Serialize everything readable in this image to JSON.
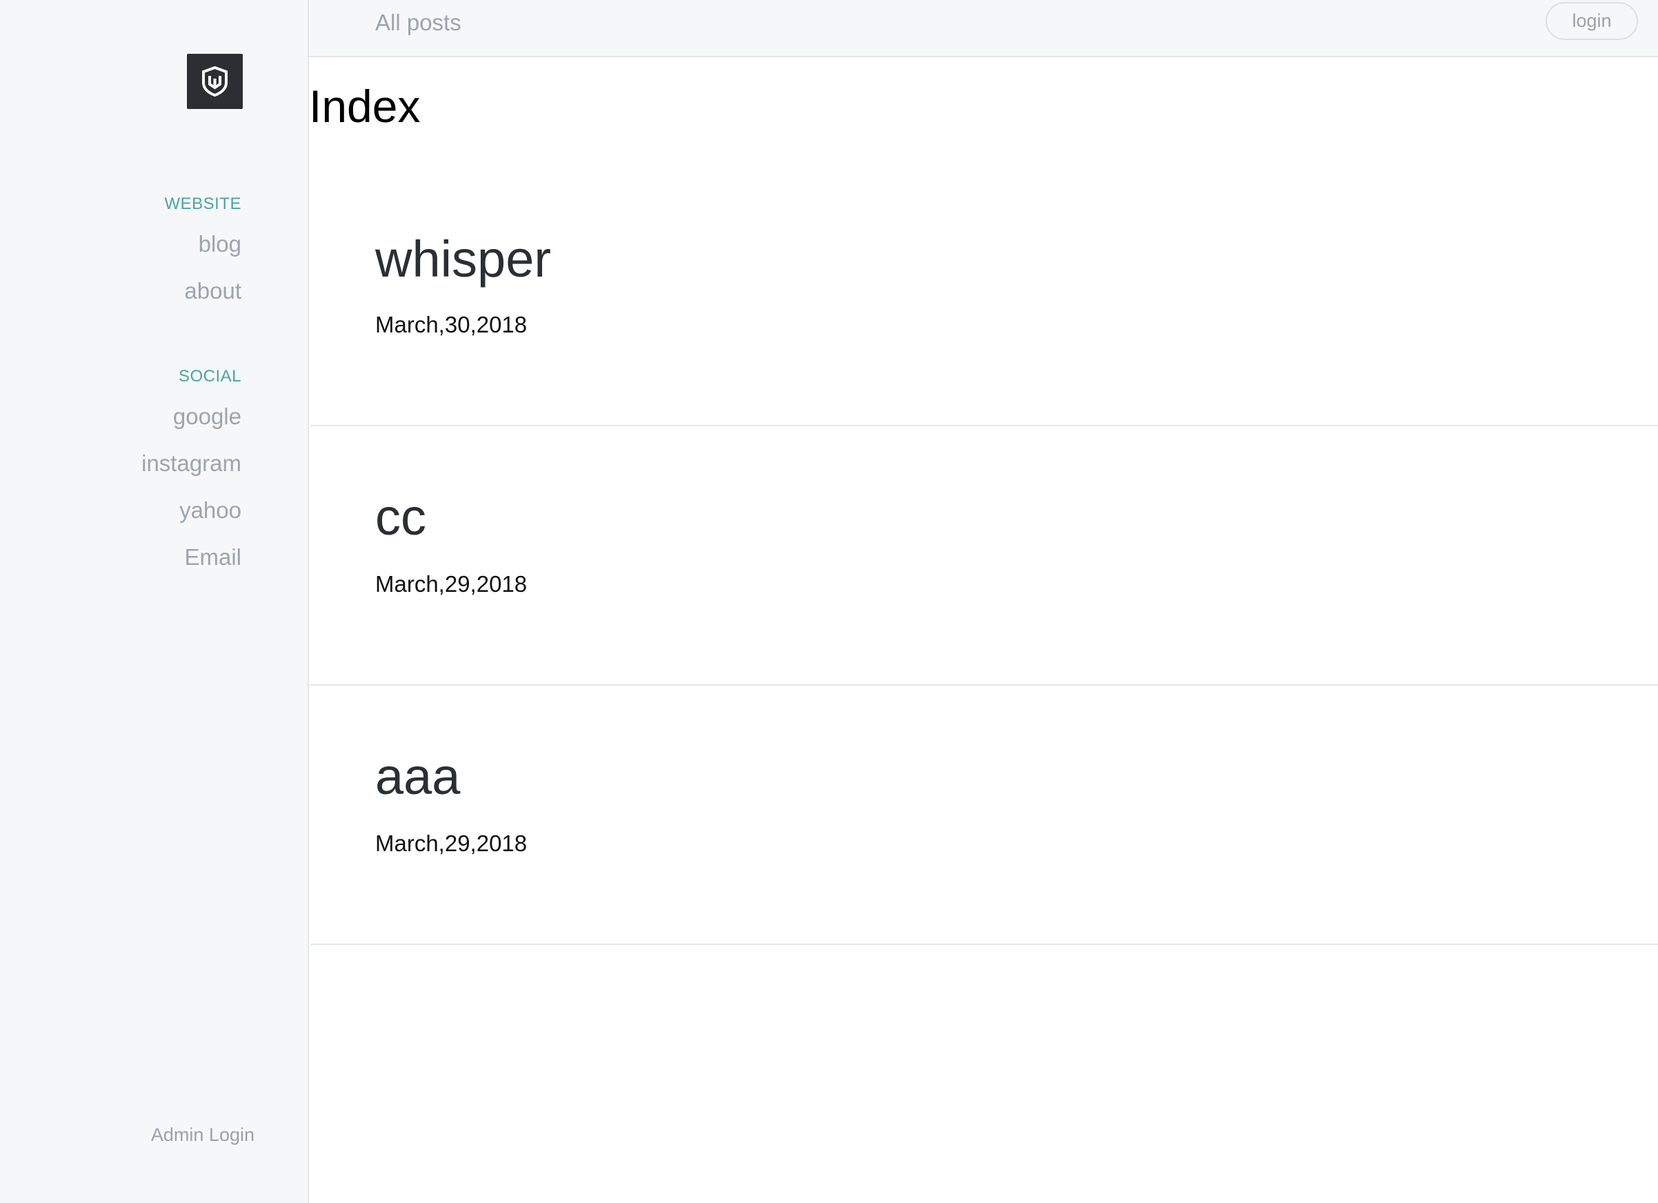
{
  "sidebar": {
    "logo": "shield-logo",
    "sections": [
      {
        "heading": "WEBSITE",
        "links": [
          {
            "label": "blog"
          },
          {
            "label": "about"
          }
        ]
      },
      {
        "heading": "SOCIAL",
        "links": [
          {
            "label": "google"
          },
          {
            "label": "instagram"
          },
          {
            "label": "yahoo"
          },
          {
            "label": "Email"
          }
        ]
      }
    ],
    "admin_login": "Admin Login"
  },
  "topbar": {
    "breadcrumb": "All posts",
    "login_label": "login"
  },
  "page": {
    "title": "Index"
  },
  "posts": [
    {
      "title": "whisper",
      "date": "March,30,2018"
    },
    {
      "title": "cc",
      "date": "March,29,2018"
    },
    {
      "title": "aaa",
      "date": "March,29,2018"
    }
  ],
  "colors": {
    "accent": "#4aa3a6",
    "sidebar_bg": "#f6f7f9",
    "logo_bg": "#2b2f33",
    "link": "#9ca5ae"
  }
}
